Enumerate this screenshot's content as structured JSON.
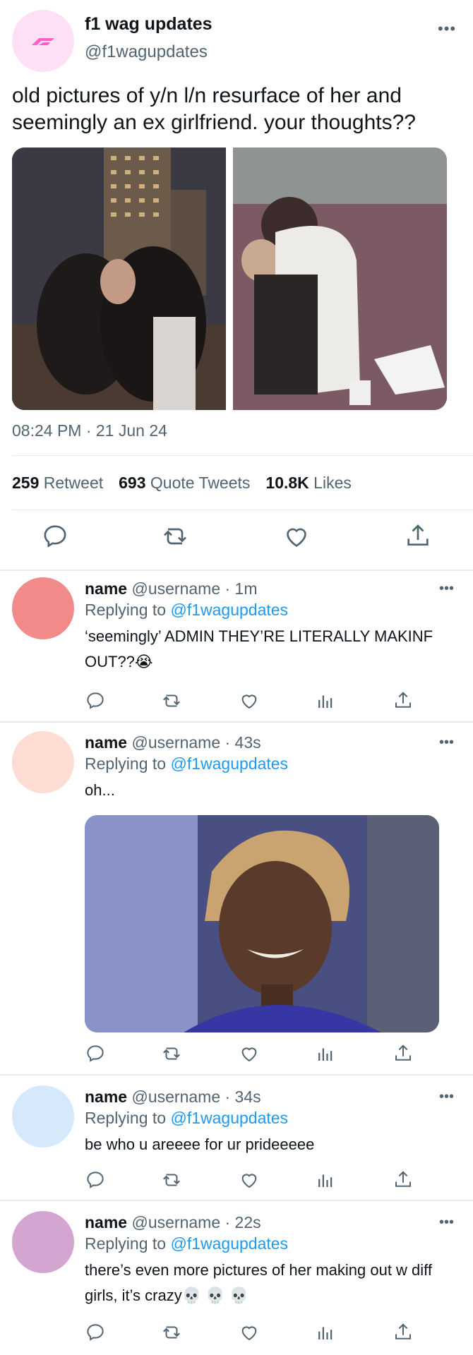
{
  "main_tweet": {
    "author_name": "f1 wag updates",
    "author_handle": "@f1wagupdates",
    "text": "old pictures of y/n l/n resurface of her and seemingly an ex girlfriend. your thoughts??",
    "timestamp": "08:24 PM · 21 Jun 24",
    "stats": {
      "retweets_count": "259",
      "retweets_label": "Retweet",
      "quotes_count": "693",
      "quotes_label": "Quote Tweets",
      "likes_count": "10.8K",
      "likes_label": "Likes"
    },
    "more_label": "•••"
  },
  "replies": [
    {
      "name": "name",
      "meta": "@username · 1m",
      "replying_prefix": "Replying to",
      "replying_to": "@f1wagupdates",
      "text": "‘seemingly’ ADMIN THEY’RE LITERALLY MAKINF OUT??😭",
      "avatar_color": "#f28a8a"
    },
    {
      "name": "name",
      "meta": "@username · 43s",
      "replying_prefix": "Replying to",
      "replying_to": "@f1wagupdates",
      "text": "oh...",
      "avatar_color": "#fdddd3"
    },
    {
      "name": "name",
      "meta": "@username · 34s",
      "replying_prefix": "Replying to",
      "replying_to": "@f1wagupdates",
      "text": "be who u areeee for ur prideeeee",
      "avatar_color": "#d6e9fb"
    },
    {
      "name": "name",
      "meta": "@username · 22s",
      "replying_prefix": "Replying to",
      "replying_to": "@f1wagupdates",
      "text": "there’s even more pictures of her making out w diff girls, it’s crazy💀 💀 💀",
      "avatar_color": "#d4a5d0"
    }
  ],
  "more_label": "•••",
  "colors": {
    "link": "#1d9bf0",
    "secondary_text": "#536471",
    "icon": "#536471"
  }
}
